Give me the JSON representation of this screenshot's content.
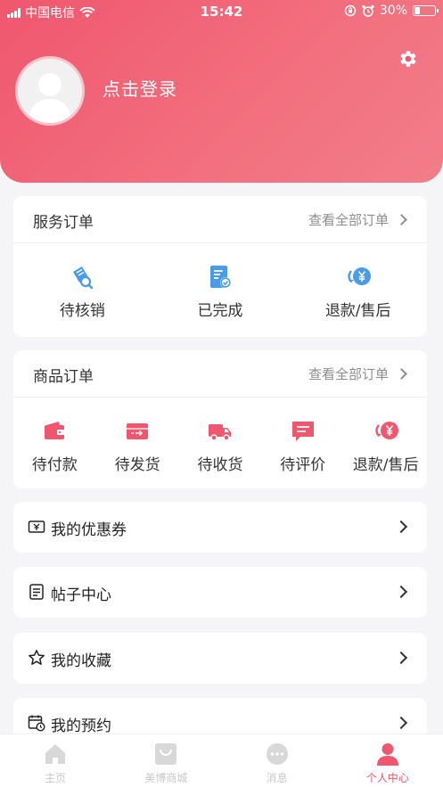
{
  "status_bar": {
    "carrier": "中国电信",
    "time": "15:42",
    "battery": "30%",
    "battery_level": 0.3
  },
  "profile": {
    "login_text": "点击登录"
  },
  "service_orders": {
    "title": "服务订单",
    "more": "查看全部订单",
    "items": [
      {
        "label": "待核销",
        "icon": "ticket-search-icon"
      },
      {
        "label": "已完成",
        "icon": "document-check-icon"
      },
      {
        "label": "退款/售后",
        "icon": "yuan-refund-icon"
      }
    ]
  },
  "goods_orders": {
    "title": "商品订单",
    "more": "查看全部订单",
    "items": [
      {
        "label": "待付款",
        "icon": "wallet-icon"
      },
      {
        "label": "待发货",
        "icon": "package-send-icon"
      },
      {
        "label": "待收货",
        "icon": "truck-icon"
      },
      {
        "label": "待评价",
        "icon": "comment-icon"
      },
      {
        "label": "退款/售后",
        "icon": "yuan-refund-icon"
      }
    ]
  },
  "menu": [
    {
      "label": "我的优惠券",
      "icon": "coupon-icon"
    },
    {
      "label": "帖子中心",
      "icon": "post-list-icon"
    },
    {
      "label": "我的收藏",
      "icon": "star-icon"
    },
    {
      "label": "我的预约",
      "icon": "calendar-clock-icon"
    }
  ],
  "tabbar": [
    {
      "label": "主页",
      "icon": "home-icon"
    },
    {
      "label": "美博商城",
      "icon": "shopping-bag-icon"
    },
    {
      "label": "消息",
      "icon": "chat-bubble-icon"
    },
    {
      "label": "个人中心",
      "icon": "person-icon",
      "active": true
    }
  ],
  "colors": {
    "accent": "#f0576e",
    "blue_icon": "#4a9be8",
    "red_icon": "#f0576e",
    "tab_inactive": "#c8c8c8"
  }
}
